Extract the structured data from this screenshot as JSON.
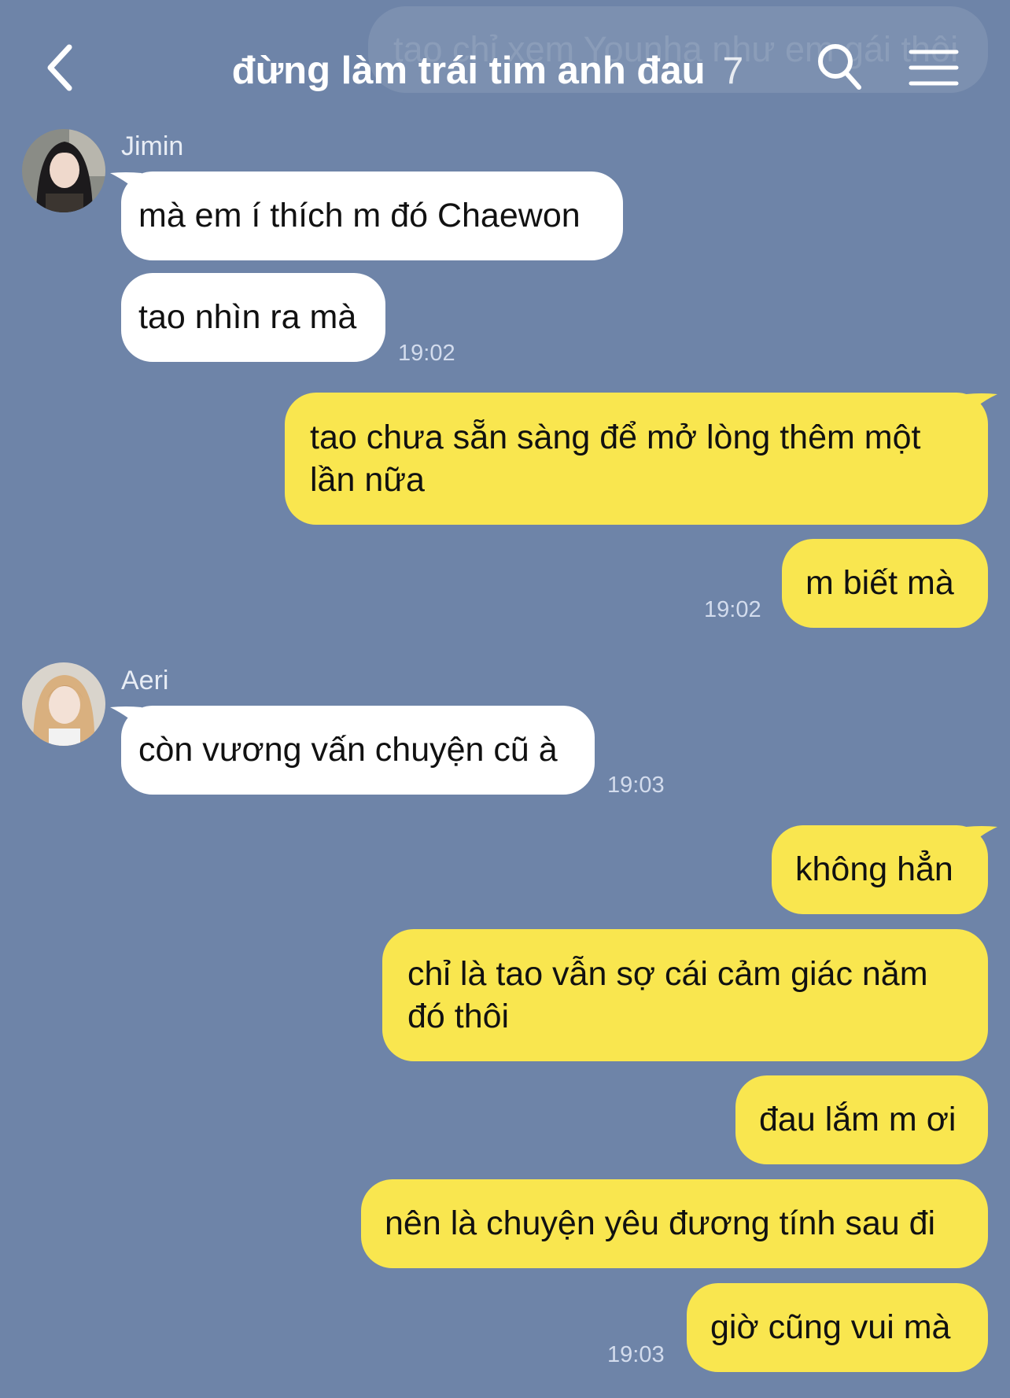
{
  "header": {
    "pinned_preview": "tao chỉ xem Younha như em gái thôi",
    "title": "đừng làm trái tim anh đau",
    "member_count": "7",
    "icons": {
      "back": "back-chevron-icon",
      "search": "search-icon",
      "menu": "menu-icon"
    }
  },
  "colors": {
    "background": "#6e84a8",
    "incoming_bubble": "#ffffff",
    "outgoing_bubble": "#f9e64f"
  },
  "messages": {
    "jimin": {
      "sender": "Jimin",
      "line1": "mà em í thích m đó Chaewon",
      "line2": "tao nhìn ra mà",
      "time": "19:02"
    },
    "me1": {
      "line1a": "tao chưa sẵn sàng để mở lòng thêm một",
      "line1b": "lần nữa",
      "line2": "m biết mà",
      "time": "19:02"
    },
    "aeri": {
      "sender": "Aeri",
      "line1": "còn vương vấn chuyện cũ à",
      "time": "19:03"
    },
    "me2": {
      "line1": "không hẳn",
      "line2a": "chỉ là tao vẫn sợ cái cảm giác năm",
      "line2b": "đó thôi",
      "line3": "đau lắm m ơi",
      "line4": "nên là chuyện yêu đương tính sau đi",
      "line5": "giờ cũng vui mà",
      "time": "19:03"
    }
  }
}
